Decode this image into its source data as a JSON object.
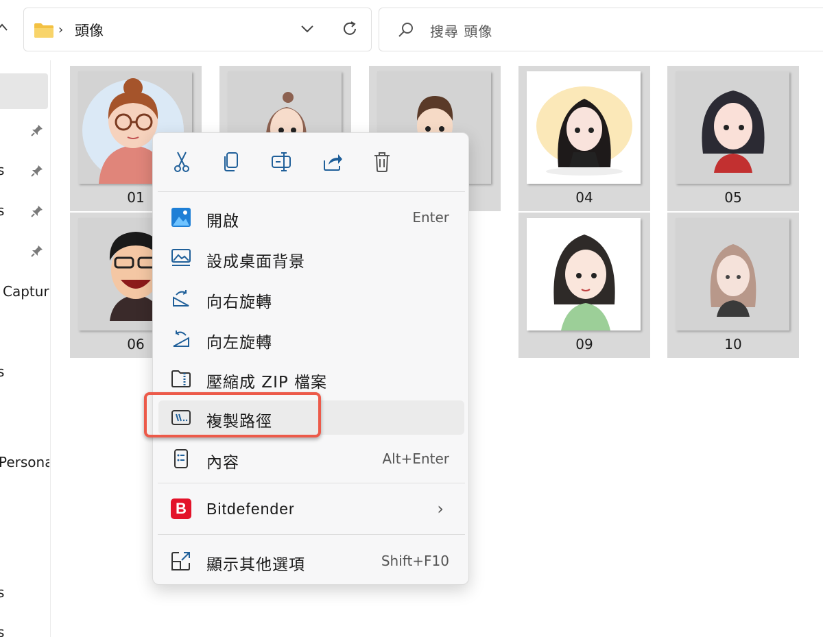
{
  "address_bar": {
    "path_separator": "›",
    "current_folder": "頭像",
    "folder_icon": "folder-icon",
    "dropdown_icon": "chevron-down-icon",
    "refresh_icon": "refresh-icon"
  },
  "search": {
    "placeholder": "搜尋 頭像",
    "icon": "search-icon"
  },
  "nav": {
    "fragments": [
      "s",
      "s",
      "Captur",
      "s",
      "Persona",
      "s",
      "s"
    ],
    "pin_icon": "pin-icon"
  },
  "thumbnails": [
    {
      "label": "01",
      "avatar": "girl-with-bun-glasses"
    },
    {
      "label": "",
      "avatar": "girl-with-bun"
    },
    {
      "label": "",
      "avatar": "boy-short-hair"
    },
    {
      "label": "04",
      "avatar": "girl-long-black-hair"
    },
    {
      "label": "05",
      "avatar": "girl-wavy-black-hair"
    },
    {
      "label": "06",
      "avatar": "laughing-man-glasses"
    },
    {
      "label": "09",
      "avatar": "woman-traditional-dress"
    },
    {
      "label": "10",
      "avatar": "girl-light-wavy-hair"
    }
  ],
  "context_menu": {
    "toolbar": [
      {
        "name": "cut",
        "icon": "scissors-icon"
      },
      {
        "name": "copy",
        "icon": "copy-icon"
      },
      {
        "name": "rename",
        "icon": "rename-icon"
      },
      {
        "name": "share",
        "icon": "share-icon"
      },
      {
        "name": "delete",
        "icon": "trash-icon"
      }
    ],
    "items": [
      {
        "label": "開啟",
        "shortcut": "Enter",
        "icon": "photos-app-icon"
      },
      {
        "label": "設成桌面背景",
        "shortcut": "",
        "icon": "set-wallpaper-icon"
      },
      {
        "label": "向右旋轉",
        "shortcut": "",
        "icon": "rotate-right-icon"
      },
      {
        "label": "向左旋轉",
        "shortcut": "",
        "icon": "rotate-left-icon"
      },
      {
        "label": "壓縮成 ZIP 檔案",
        "shortcut": "",
        "icon": "zip-folder-icon"
      },
      {
        "label": "複製路徑",
        "shortcut": "",
        "icon": "copy-path-icon"
      },
      {
        "label": "內容",
        "shortcut": "Alt+Enter",
        "icon": "properties-icon"
      },
      {
        "label": "Bitdefender",
        "shortcut": "",
        "icon": "bitdefender-icon",
        "badge": "B"
      },
      {
        "label": "顯示其他選項",
        "shortcut": "Shift+F10",
        "icon": "more-options-icon"
      }
    ],
    "submenu_arrow": "›",
    "highlighted_item": "複製路徑"
  },
  "colors": {
    "accent": "#0067c0",
    "highlight_border": "#ec5a4a",
    "thumb_bg": "#d9d9d9",
    "bitdefender_red": "#e3132a"
  }
}
